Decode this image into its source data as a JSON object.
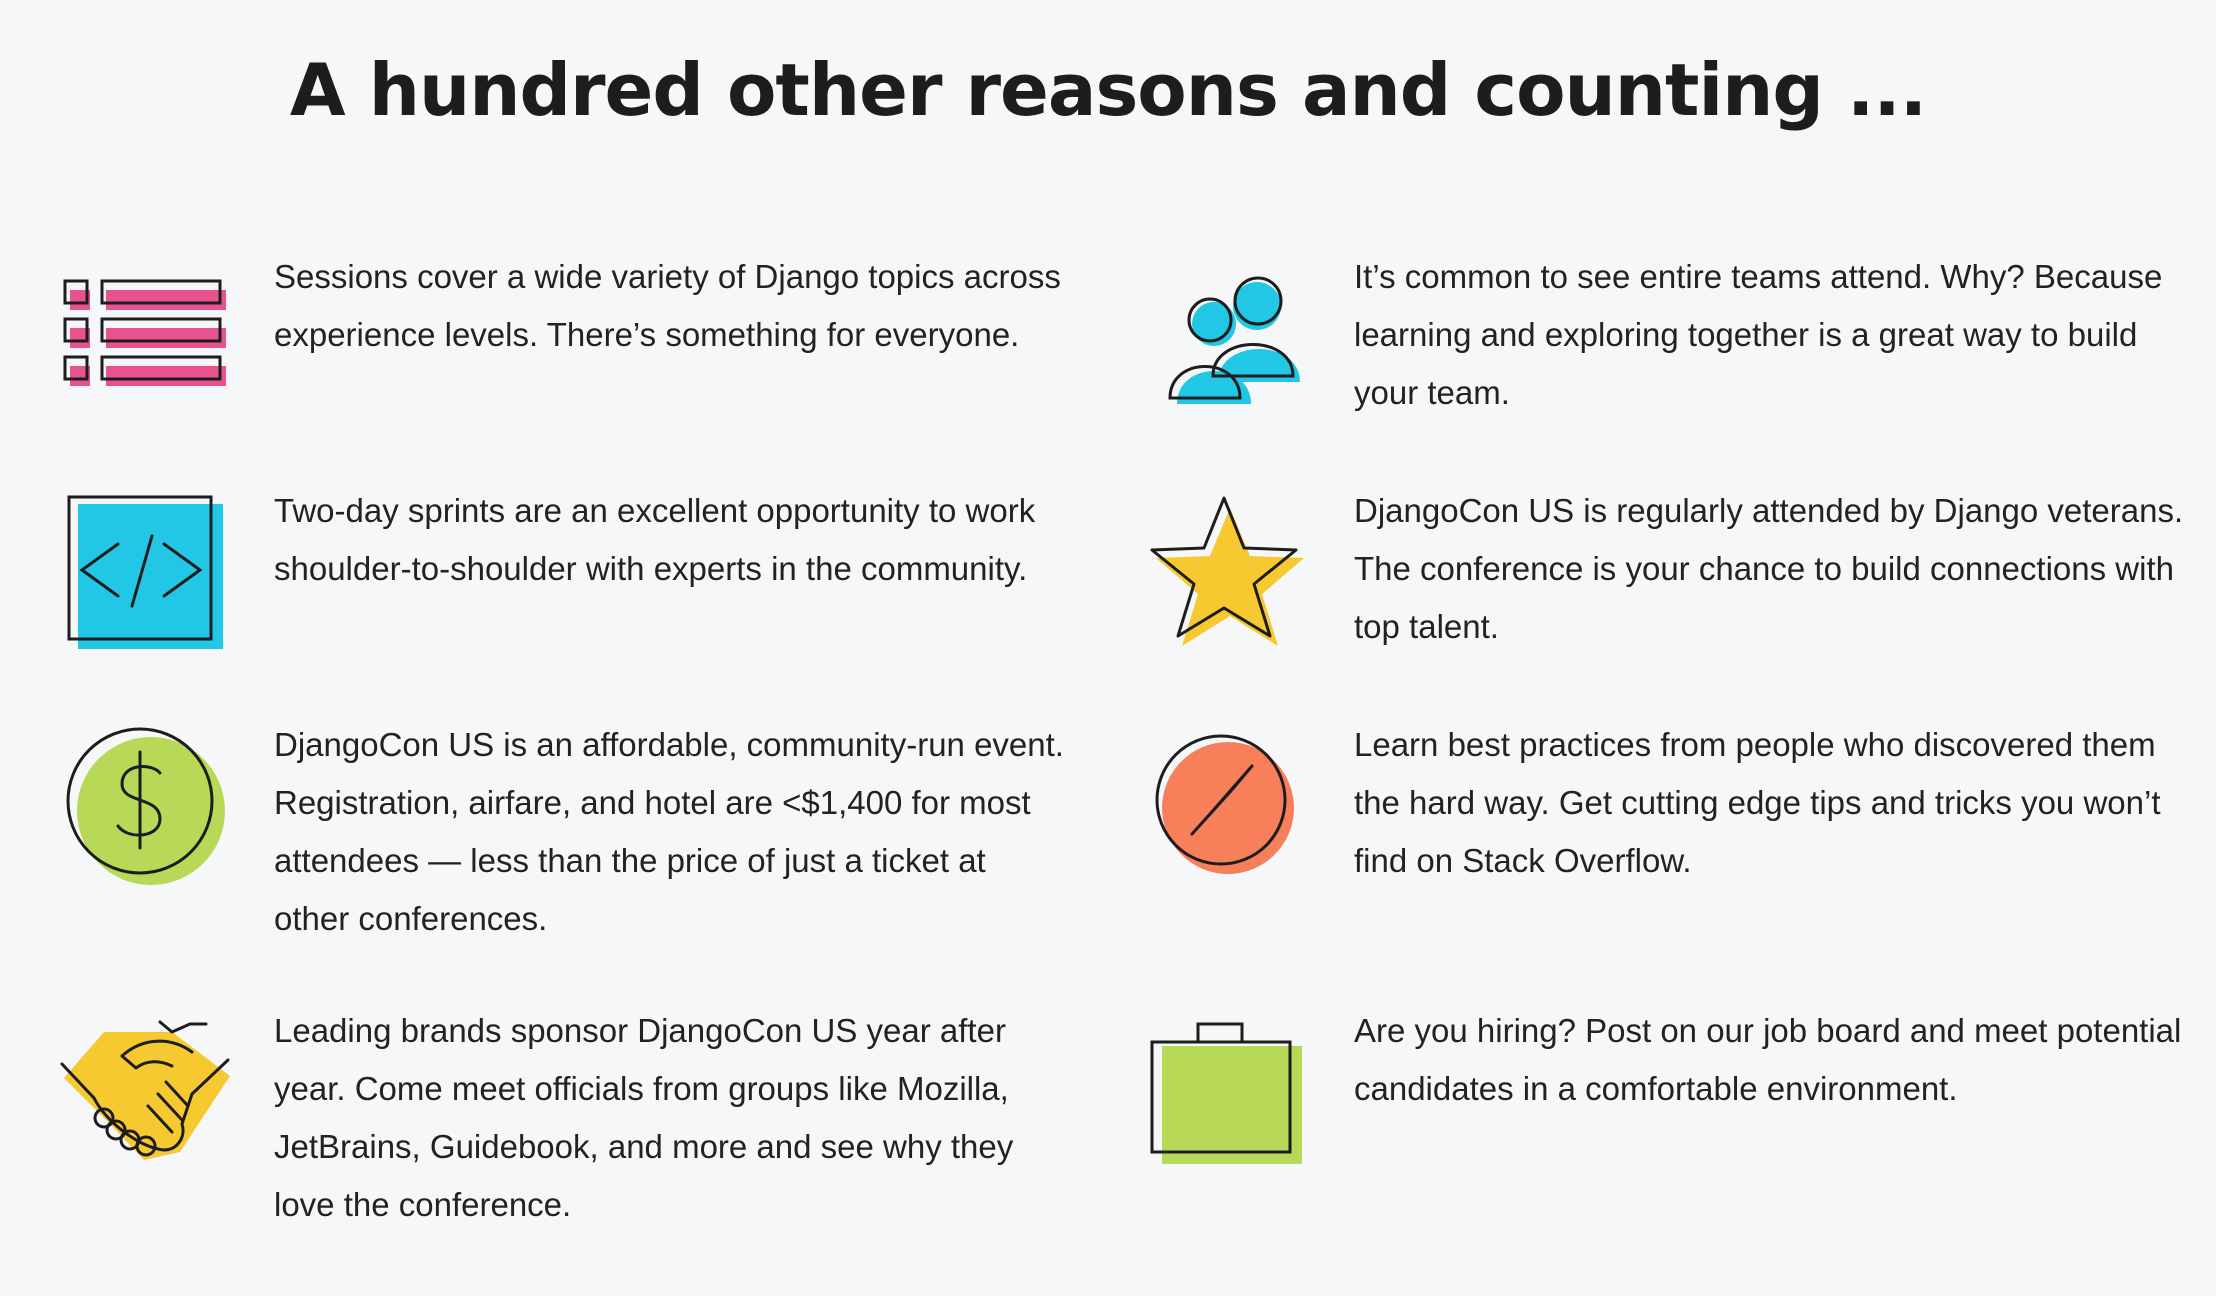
{
  "title": "A hundred other reasons and counting ...",
  "colors": {
    "background": "#f6f7f9",
    "pink": "#e8528f",
    "cyan": "#22c7e5",
    "yellow": "#f6c930",
    "green": "#b8d957",
    "orange": "#f7805a",
    "outline": "#1d1d1d"
  },
  "reasons": [
    {
      "icon": "list-icon",
      "text": "Sessions cover a wide variety of Django topics across experience levels. There’s something for everyone."
    },
    {
      "icon": "team-icon",
      "text": "It’s common to see entire teams attend. Why? Because learning and exploring together is a great way to build your team."
    },
    {
      "icon": "code-icon",
      "text": "Two-day sprints are an excellent opportunity to work shoulder-to-shoulder with experts in the community."
    },
    {
      "icon": "star-icon",
      "text": "DjangoCon US is regularly attended by Django veterans. The conference is your chance to build connections with top talent."
    },
    {
      "icon": "dollar-icon",
      "text": "DjangoCon US is an affordable, community-run event. Registration, airfare, and hotel are <$1,400 for most attendees — less than the price of just a ticket at other conferences."
    },
    {
      "icon": "compass-icon",
      "text": "Learn best practices from people who discovered them the hard way. Get cutting edge tips and tricks you won’t find on Stack Overflow."
    },
    {
      "icon": "handshake-icon",
      "text": "Leading brands sponsor DjangoCon US year after year. Come meet officials from groups like Mozilla, JetBrains, Guidebook, and more and see why they love the conference."
    },
    {
      "icon": "briefcase-icon",
      "text": "Are you hiring? Post on our job board and meet potential candidates in a comfortable environment."
    }
  ]
}
